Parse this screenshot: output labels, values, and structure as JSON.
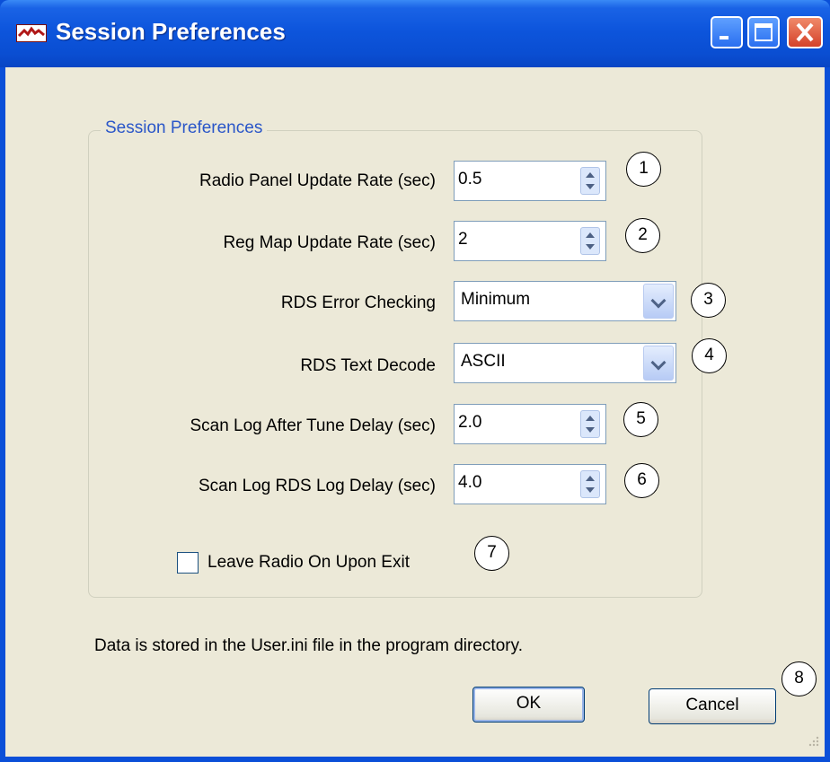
{
  "window": {
    "title": "Session Preferences",
    "icon": "app-logo-icon"
  },
  "titlebar_buttons": [
    "minimize-icon",
    "maximize-icon",
    "close-icon"
  ],
  "group": {
    "label": "Session Preferences",
    "fields": {
      "radio_panel_rate": {
        "label": "Radio Panel  Update Rate (sec)",
        "value": "0.5",
        "callout": "1"
      },
      "reg_map_rate": {
        "label": "Reg Map Update Rate (sec)",
        "value": "2",
        "callout": "2"
      },
      "rds_error": {
        "label": "RDS Error Checking",
        "value": "Minimum",
        "callout": "3"
      },
      "rds_text": {
        "label": "RDS Text Decode",
        "value": "ASCII",
        "callout": "4"
      },
      "scan_after_tune": {
        "label": "Scan Log After Tune Delay (sec)",
        "value": "2.0",
        "callout": "5"
      },
      "scan_rds_delay": {
        "label": "Scan Log RDS Log Delay (sec)",
        "value": "4.0",
        "callout": "6"
      }
    },
    "leave_radio_on": {
      "label": "Leave Radio On Upon Exit",
      "checked": false,
      "callout": "7"
    }
  },
  "note": "Data is stored in the User.ini file in the program directory.",
  "buttons": {
    "ok": "OK",
    "cancel": "Cancel",
    "callout": "8"
  }
}
